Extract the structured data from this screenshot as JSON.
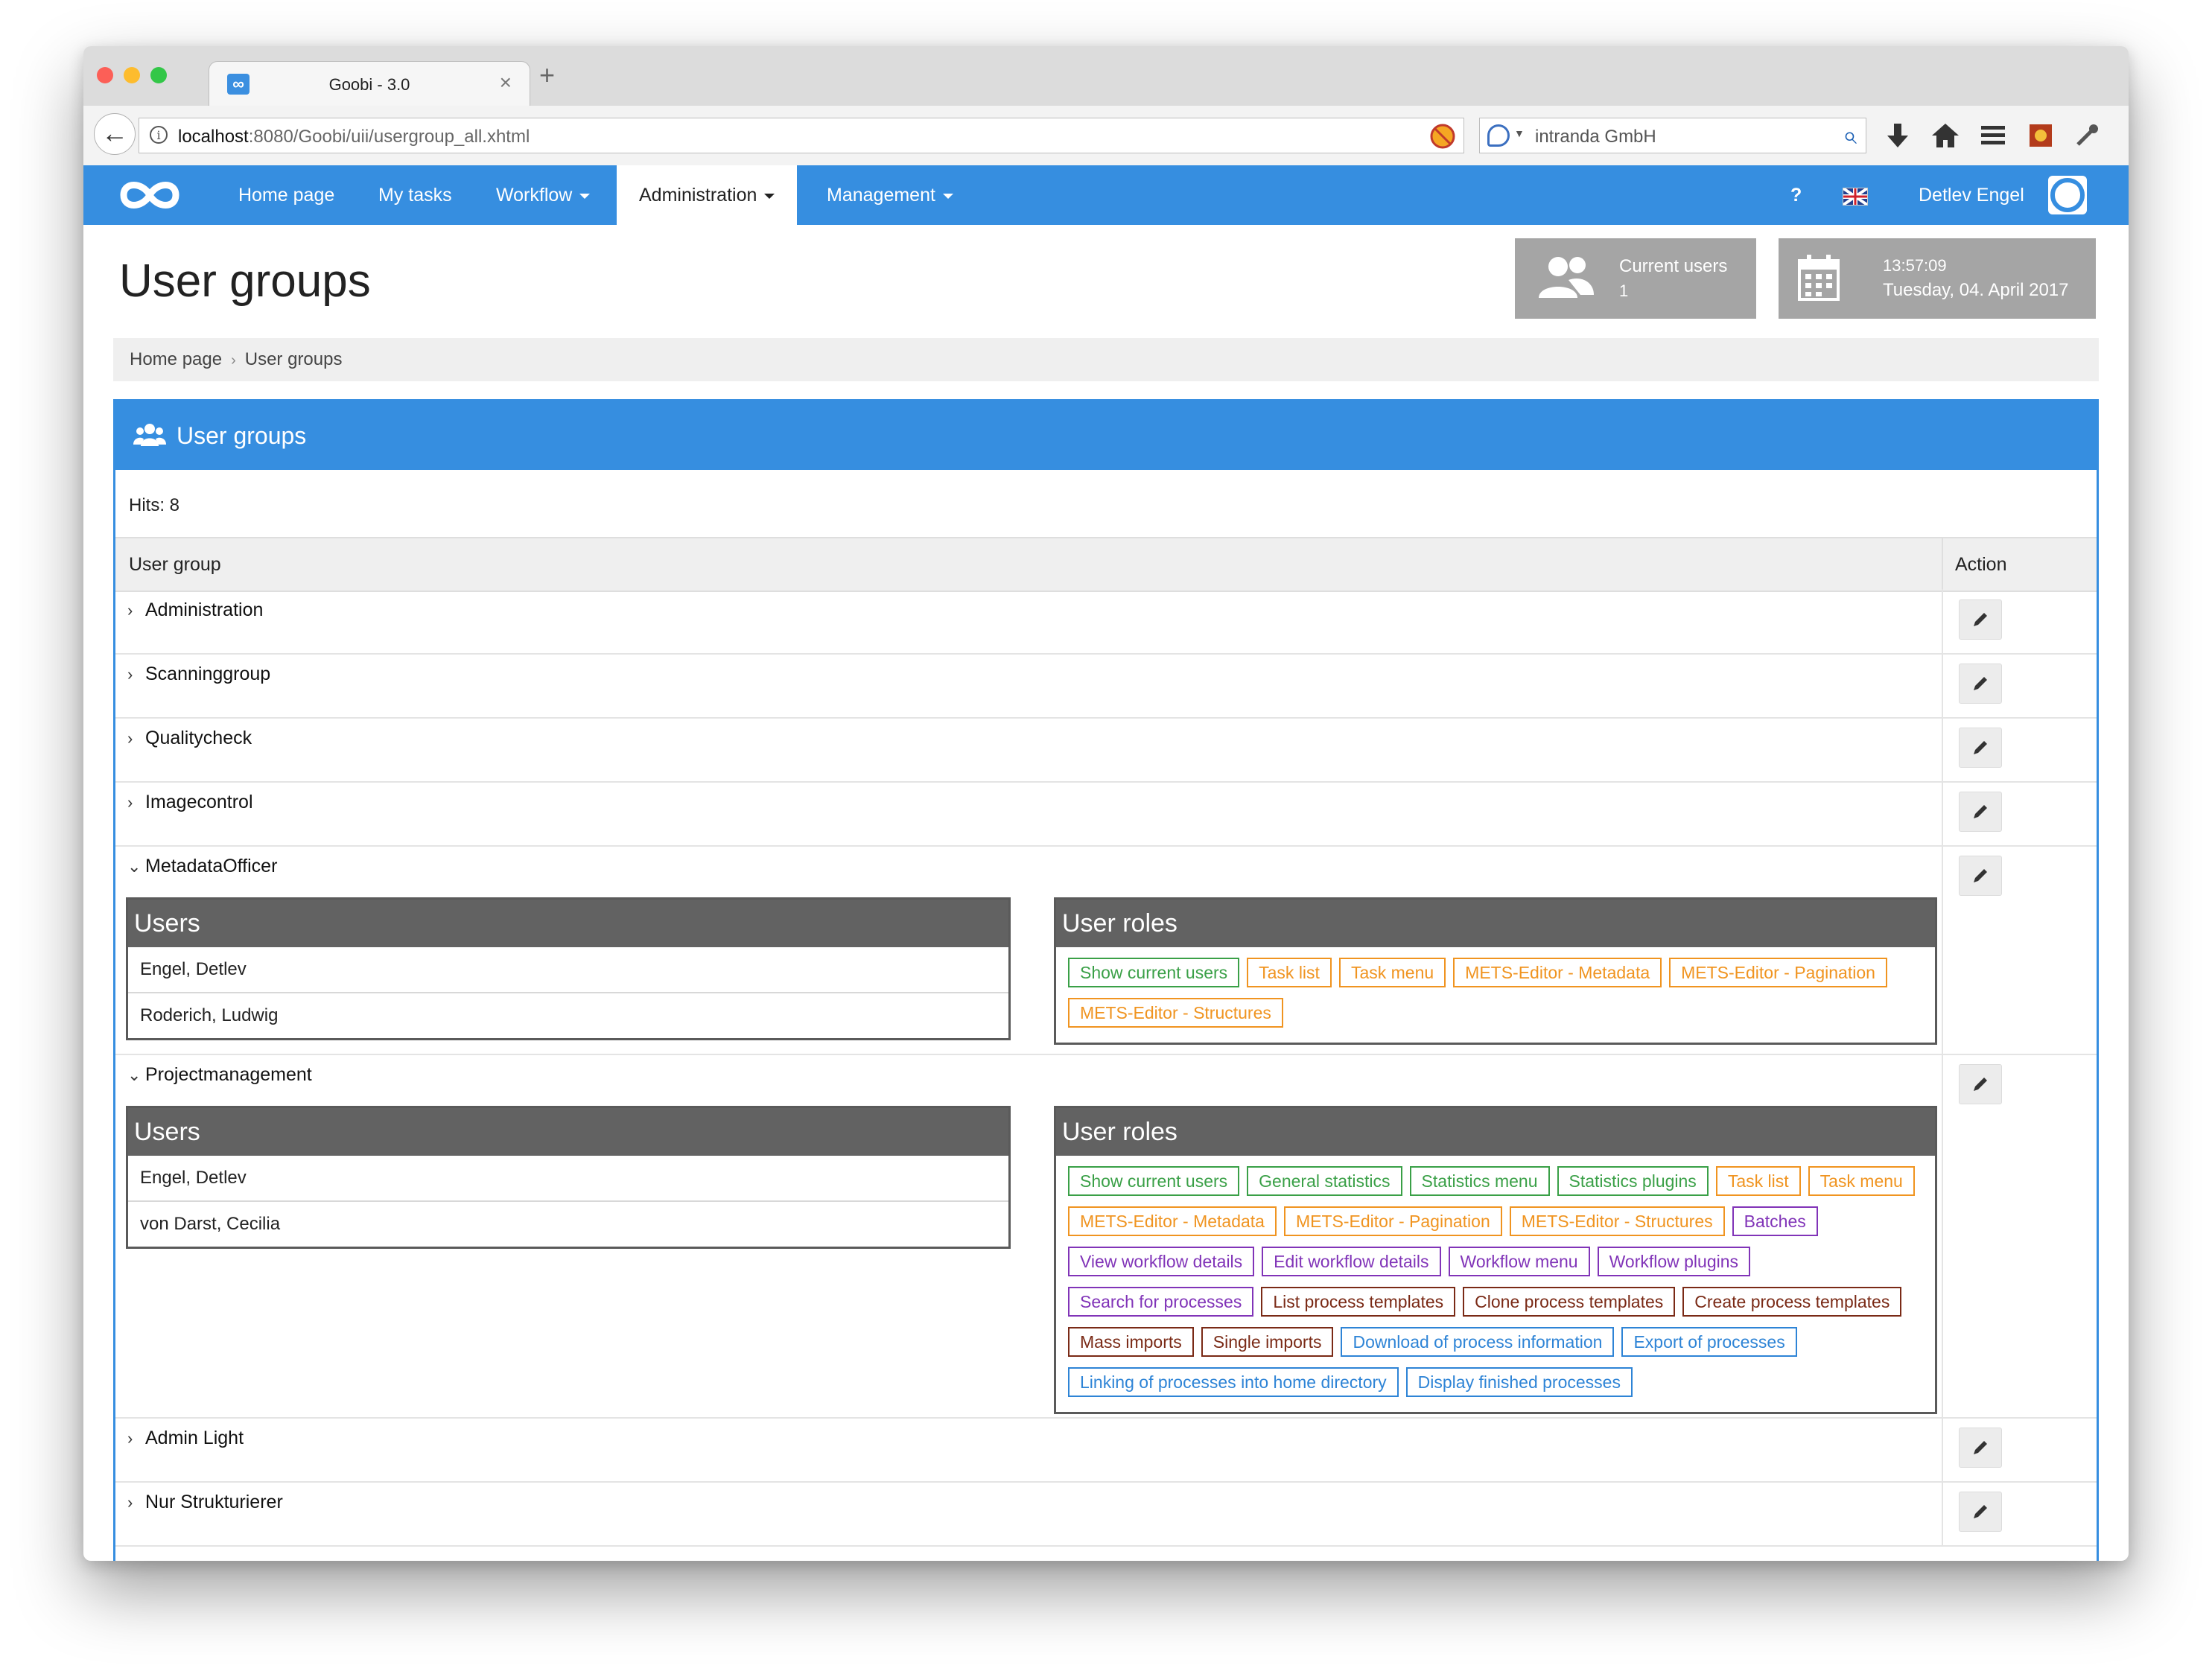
{
  "browser": {
    "tab_title": "Goobi - 3.0",
    "tab_icon": "infinity-icon",
    "new_tab": "+",
    "close": "×",
    "url_host": "localhost",
    "url_rest": ":8080/Goobi/uii/usergroup_all.xhtml",
    "search_text": "intranda GmbH",
    "icons": [
      "back-icon",
      "info-icon",
      "reload-icon",
      "blocked-icon",
      "search-icon",
      "download-icon",
      "home-icon",
      "menu-icon",
      "addon-icon",
      "eyedropper-icon"
    ]
  },
  "nav": {
    "home": "Home page",
    "tasks": "My tasks",
    "workflow": "Workflow",
    "administration": "Administration",
    "management": "Management",
    "help": "?",
    "user": "Detlev Engel",
    "brand_color": "#368ee0"
  },
  "page": {
    "title": "User groups",
    "current_users_label": "Current users",
    "current_users_count": "1",
    "time": "13:57:09",
    "date": "Tuesday, 04. April 2017"
  },
  "breadcrumb": [
    "Home page",
    "User groups"
  ],
  "panel": {
    "title": "User groups",
    "hits": "Hits: 8",
    "col_group": "User group",
    "col_action": "Action"
  },
  "groups": [
    {
      "name": "Administration",
      "expanded": false
    },
    {
      "name": "Scanninggroup",
      "expanded": false
    },
    {
      "name": "Qualitycheck",
      "expanded": false
    },
    {
      "name": "Imagecontrol",
      "expanded": false
    },
    {
      "name": "MetadataOfficer",
      "expanded": true,
      "users_title": "Users",
      "roles_title": "User roles",
      "users": [
        "Engel, Detlev",
        "Roderich, Ludwig"
      ],
      "roles": [
        {
          "label": "Show current users",
          "color": "green"
        },
        {
          "label": "Task list",
          "color": "orange"
        },
        {
          "label": "Task menu",
          "color": "orange"
        },
        {
          "label": "METS-Editor - Metadata",
          "color": "orange"
        },
        {
          "label": "METS-Editor - Pagination",
          "color": "orange"
        },
        {
          "label": "METS-Editor - Structures",
          "color": "orange"
        }
      ]
    },
    {
      "name": "Projectmanagement",
      "expanded": true,
      "users_title": "Users",
      "roles_title": "User roles",
      "users": [
        "Engel, Detlev",
        "von Darst, Cecilia"
      ],
      "roles": [
        {
          "label": "Show current users",
          "color": "green"
        },
        {
          "label": "General statistics",
          "color": "green"
        },
        {
          "label": "Statistics menu",
          "color": "green"
        },
        {
          "label": "Statistics plugins",
          "color": "green"
        },
        {
          "label": "Task list",
          "color": "orange"
        },
        {
          "label": "Task menu",
          "color": "orange"
        },
        {
          "label": "METS-Editor - Metadata",
          "color": "orange"
        },
        {
          "label": "METS-Editor - Pagination",
          "color": "orange"
        },
        {
          "label": "METS-Editor - Structures",
          "color": "orange"
        },
        {
          "label": "Batches",
          "color": "purple"
        },
        {
          "label": "View workflow details",
          "color": "purple"
        },
        {
          "label": "Edit workflow details",
          "color": "purple"
        },
        {
          "label": "Workflow menu",
          "color": "purple"
        },
        {
          "label": "Workflow plugins",
          "color": "purple"
        },
        {
          "label": "Search for processes",
          "color": "purple"
        },
        {
          "label": "List process templates",
          "color": "brown"
        },
        {
          "label": "Clone process templates",
          "color": "brown"
        },
        {
          "label": "Create process templates",
          "color": "brown"
        },
        {
          "label": "Mass imports",
          "color": "brown"
        },
        {
          "label": "Single imports",
          "color": "brown"
        },
        {
          "label": "Download of process information",
          "color": "blue"
        },
        {
          "label": "Export of processes",
          "color": "blue"
        },
        {
          "label": "Linking of processes into home directory",
          "color": "blue"
        },
        {
          "label": "Display finished processes",
          "color": "blue"
        }
      ]
    },
    {
      "name": "Admin Light",
      "expanded": false
    },
    {
      "name": "Nur Strukturierer",
      "expanded": false
    }
  ]
}
